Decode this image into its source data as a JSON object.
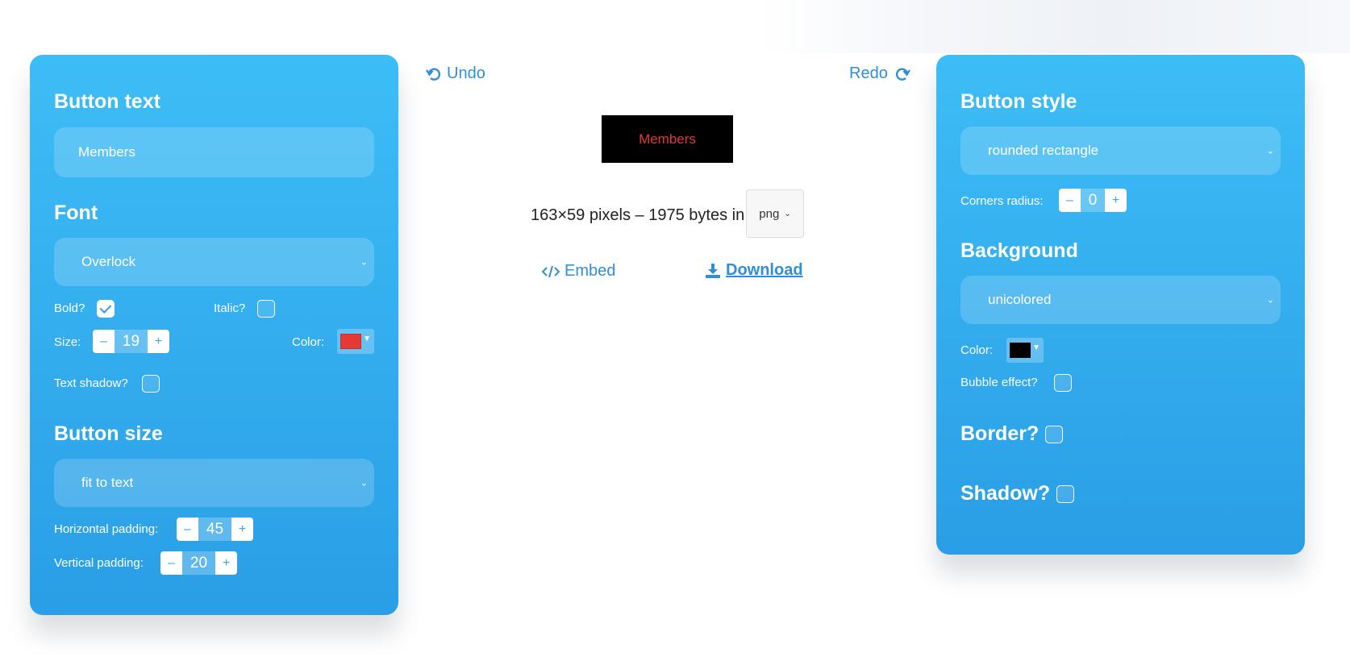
{
  "left_panel": {
    "button_text": {
      "heading": "Button text",
      "value": "Members"
    },
    "font": {
      "heading": "Font",
      "selected": "Overlock",
      "bold_label": "Bold?",
      "bold_checked": true,
      "italic_label": "Italic?",
      "italic_checked": false,
      "size_label": "Size:",
      "size_value": "19",
      "color_label": "Color:",
      "color": "#e53935",
      "text_shadow_label": "Text shadow?",
      "text_shadow_checked": false
    },
    "button_size": {
      "heading": "Button size",
      "selected": "fit to text",
      "hpad_label": "Horizontal padding:",
      "hpad_value": "45",
      "vpad_label": "Vertical padding:",
      "vpad_value": "20"
    }
  },
  "center": {
    "undo_label": "Undo",
    "redo_label": "Redo",
    "preview_text": "Members",
    "preview_bg": "#000000",
    "preview_fg": "#e03a3a",
    "info_text": "163×59 pixels – 1975 bytes in",
    "format_selected": "png",
    "embed_label": "Embed",
    "download_label": "Download"
  },
  "right_panel": {
    "button_style": {
      "heading": "Button style",
      "selected": "rounded rectangle",
      "corners_label": "Corners radius:",
      "corners_value": "0"
    },
    "background": {
      "heading": "Background",
      "selected": "unicolored",
      "color_label": "Color:",
      "color": "#000000",
      "bubble_label": "Bubble effect?",
      "bubble_checked": false
    },
    "border": {
      "label": "Border?",
      "checked": false
    },
    "shadow": {
      "label": "Shadow?",
      "checked": false
    }
  },
  "stepper_minus": "–",
  "stepper_plus": "+",
  "icons": {
    "undo": "undo-icon",
    "redo": "redo-icon",
    "embed": "code-icon",
    "download": "download-icon",
    "chevron": "chevron-down-icon"
  },
  "colors": {
    "panel_top": "#3dbdf6",
    "panel_bottom": "#2a9ee6",
    "link": "#2f8fd6"
  }
}
